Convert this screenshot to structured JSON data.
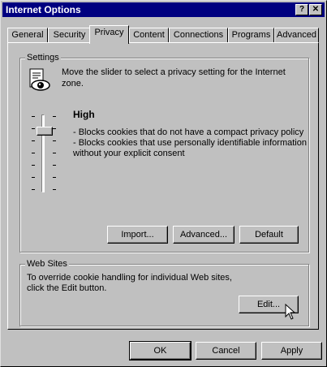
{
  "window": {
    "title": "Internet Options",
    "help_label": "?",
    "close_label": "✕"
  },
  "tabs": [
    {
      "label": "General"
    },
    {
      "label": "Security"
    },
    {
      "label": "Privacy"
    },
    {
      "label": "Content"
    },
    {
      "label": "Connections"
    },
    {
      "label": "Programs"
    },
    {
      "label": "Advanced"
    }
  ],
  "settings": {
    "group_label": "Settings",
    "description": "Move the slider to select a privacy setting for the Internet",
    "description2": "zone.",
    "level_title": "High",
    "bullet1": "- Blocks cookies that do not have a compact privacy policy",
    "bullet2": "- Blocks cookies that use personally identifiable information",
    "bullet2b": "without your explicit consent",
    "import_label": "Import...",
    "advanced_label": "Advanced...",
    "default_label": "Default"
  },
  "websites": {
    "group_label": "Web Sites",
    "description": "To override cookie handling for individual Web sites,",
    "description2": "click the Edit button.",
    "edit_label": "Edit..."
  },
  "footer": {
    "ok_label": "OK",
    "cancel_label": "Cancel",
    "apply_label": "Apply"
  },
  "icons": {
    "privacy": "privacy-eye-icon",
    "cursor": "mouse-pointer-icon"
  }
}
